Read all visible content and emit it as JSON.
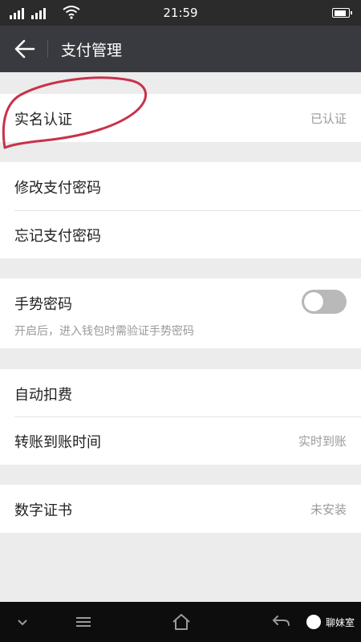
{
  "status_bar": {
    "time": "21:59"
  },
  "header": {
    "title": "支付管理"
  },
  "sections": {
    "real_name": {
      "label": "实名认证",
      "value": "已认证"
    },
    "password": {
      "modify_label": "修改支付密码",
      "forgot_label": "忘记支付密码"
    },
    "gesture": {
      "label": "手势密码",
      "description": "开启后，进入钱包时需验证手势密码",
      "enabled": false
    },
    "billing": {
      "auto_debit_label": "自动扣费",
      "transfer_time_label": "转账到账时间",
      "transfer_time_value": "实时到账"
    },
    "certificate": {
      "label": "数字证书",
      "value": "未安装"
    }
  },
  "watermark": {
    "text": "聊妹室"
  },
  "colors": {
    "status_bar_bg": "#2b2b2b",
    "title_bar_bg": "#393a3f",
    "page_bg": "#ececec",
    "annotation": "#c8324b",
    "toggle_off": "#b9b9b9"
  }
}
